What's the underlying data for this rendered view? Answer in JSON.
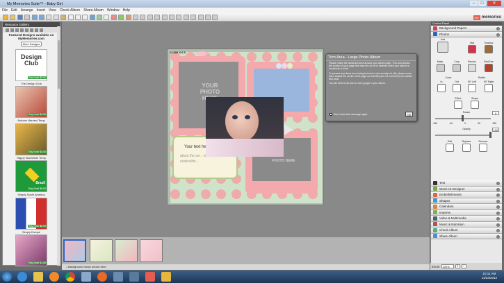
{
  "window": {
    "title": "My Memories Suite™ - Baby Girl"
  },
  "menu": [
    "File",
    "Edit",
    "Arrange",
    "Insert",
    "View",
    "Check Album",
    "Share Album",
    "Window",
    "Help"
  ],
  "brand": {
    "badge": "my",
    "name": "memories"
  },
  "left_panel": {
    "header": "Resource Gallery",
    "featured_text": "Featured Designs available on MyMemories.com",
    "more_button": "More Designs",
    "items": [
      {
        "label": "The Design Club",
        "price": "Buy Now! $5.00",
        "thumb_text": "Design Club"
      },
      {
        "label": "Autumn Harvest Temp",
        "price": "Buy Now! $4.00"
      },
      {
        "label": "Happy November Temp",
        "price": "Buy Now! $4.00"
      },
      {
        "label": "Simply South America",
        "price": "Buy Now! $6.00",
        "thumb_text": "Brazil"
      },
      {
        "label": "Simply Europe",
        "price": "Buy Now! $6.00"
      },
      {
        "label": "",
        "price": "Buy Now! $1.00"
      }
    ]
  },
  "canvas": {
    "size_label": "12.000 X 6.5",
    "page_text": {
      "photo1": "YOUR PHOTO HERE",
      "photo2": "PHOTO HERE",
      "journal_title": "Your text he",
      "journal_body": "about the sw... ribbons, underslitts..."
    }
  },
  "tooltip": {
    "title": "Trim Area - Large Photo Album",
    "p1": "Please notice the darkened area around your album page. This area shows the portion of your page that may be cut off or trimmed when your album is bound into a book.",
    "p2": "To prevent any items from being trimmed or (incorrectly cut off), please move them toward the center of the page so that they are not covered by the darker trim area.",
    "p3": "You will need to do this for every page in your album.",
    "checkbox": "Don't show this message again.",
    "ok": "OK"
  },
  "status": {
    "text": "Background music shows here"
  },
  "right_panel": {
    "header": "Control Panel",
    "sections_top": [
      {
        "label": "Background Papers",
        "color": "#c45"
      },
      {
        "label": "Photos",
        "color": "#2a66b8"
      }
    ],
    "photo_buttons": {
      "add": "Add",
      "mat": "Mat",
      "shadow": "Shadow",
      "mask": "Mask",
      "crop": "Crop",
      "recolor": "Recolor",
      "red_eye": "Red Eye",
      "zoom": "Zoom",
      "rotate": "Rotate",
      "in": "In",
      "out": "Out",
      "left": "90° Left",
      "right": "90° Right",
      "effect": "Effect",
      "shape": "Shape",
      "edit": "Edit",
      "replace": "Replace",
      "remove": "Remove"
    },
    "rotate_label": "Rotate",
    "rotate_value": "0",
    "opacity_label": "Opacity",
    "opacity_value": "100",
    "ticks": [
      "-180",
      "-90",
      "0",
      "90",
      "180"
    ],
    "sections_bottom": [
      {
        "label": "Text",
        "color": "#333"
      },
      {
        "label": "Word Art Designer",
        "color": "#7a4"
      },
      {
        "label": "Embellishments",
        "color": "#d64"
      },
      {
        "label": "Shapes",
        "color": "#49c"
      },
      {
        "label": "Calendars",
        "color": "#c84"
      },
      {
        "label": "Imprints",
        "color": "#8a5"
      },
      {
        "label": "Video & Multimedia",
        "color": "#466"
      },
      {
        "label": "Music & Narration",
        "color": "#a55"
      },
      {
        "label": "Check Album",
        "color": "#5a8"
      },
      {
        "label": "Share Album",
        "color": "#58c"
      }
    ],
    "zoom_label": "Zoom",
    "zoom_value": "100%"
  },
  "taskbar": {
    "time": "10:11 AM",
    "date": "11/23/2012"
  }
}
